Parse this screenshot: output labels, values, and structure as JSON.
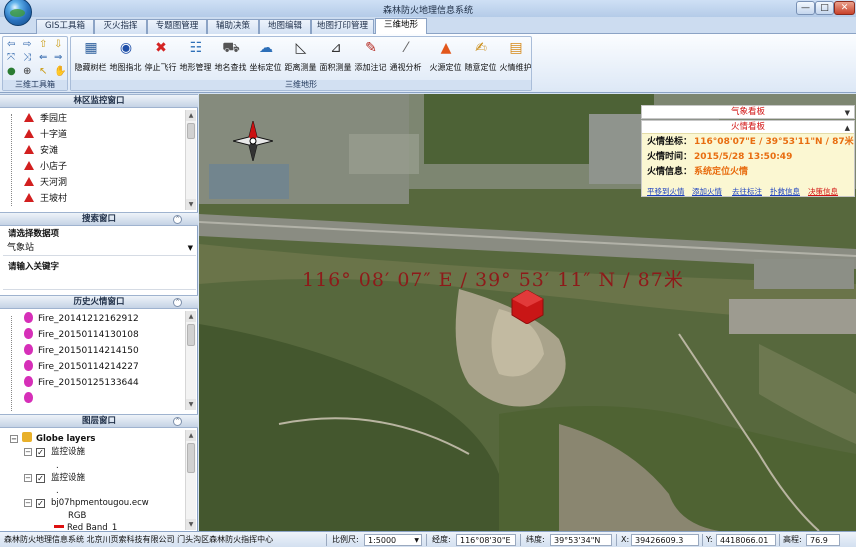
{
  "window": {
    "title": "森林防火地理信息系统",
    "min_glyph": "—",
    "max_glyph": "□",
    "close_glyph": "✕"
  },
  "tabs": [
    {
      "label": "GIS工具箱"
    },
    {
      "label": "灭火指挥"
    },
    {
      "label": "专题图管理"
    },
    {
      "label": "辅助决策"
    },
    {
      "label": "地图编辑"
    },
    {
      "label": "地图打印管理"
    },
    {
      "label": "三维地形",
      "active": true
    }
  ],
  "ribbon": {
    "group_3d_tools": "三维工具箱",
    "group_map": "三维地形",
    "buttons": [
      {
        "label": "隐藏树栏",
        "icon": "grid-icon"
      },
      {
        "label": "地图指北",
        "icon": "compass-icon"
      },
      {
        "label": "停止飞行",
        "icon": "stop-icon"
      },
      {
        "label": "地形管理",
        "icon": "terrain-icon"
      },
      {
        "label": "地名查找",
        "icon": "place-search-icon"
      },
      {
        "label": "坐标定位",
        "icon": "coordinate-icon"
      },
      {
        "label": "距离测量",
        "icon": "distance-icon"
      },
      {
        "label": "面积测量",
        "icon": "area-icon"
      },
      {
        "label": "添加注记",
        "icon": "annotation-icon"
      },
      {
        "label": "通视分析",
        "icon": "sightline-icon"
      },
      {
        "label": "火源定位",
        "icon": "fire-locate-icon"
      },
      {
        "label": "随意定位",
        "icon": "free-locate-icon"
      },
      {
        "label": "火情维护",
        "icon": "fire-maintain-icon"
      }
    ]
  },
  "left": {
    "monitor_title": "林区监控窗口",
    "monitor_items": [
      "季园庄",
      "十字道",
      "安滩",
      "小店子",
      "天河洞",
      "王坡村"
    ],
    "search_title": "搜索窗口",
    "search_label": "请选择数据项",
    "search_value": "气象站",
    "keyword_label": "请输入关键字",
    "keyword_value": "",
    "history_title": "历史火情窗口",
    "history_items": [
      "Fire_20141212162912",
      "Fire_20150114130108",
      "Fire_20150114214150",
      "Fire_20150114214227",
      "Fire_20150125133644"
    ],
    "layers_title": "图层窗口",
    "layers": {
      "root": "Globe layers",
      "l1": "监控设施",
      "l2": "监控设施",
      "l3": "bj07hpmentougou.ecw",
      "l4": "RGB",
      "l5": "Red Band_1"
    }
  },
  "map": {
    "coord_text": "116° 08′ 07″ E / 39° 53′ 11″ N / 87米"
  },
  "weather_panel": {
    "title": "气象看板"
  },
  "fire_panel": {
    "title": "火情看板",
    "coord_label": "火情坐标：",
    "coord_value": "116°08'07\"E / 39°53'11\"N / 87米",
    "time_label": "火情时间：",
    "time_value": "2015/5/28 13:50:49",
    "info_label": "火情信息：",
    "info_value": "系统定位火情",
    "links": [
      "平移到火情",
      "添加火情",
      "去往标注",
      "扑救信息",
      "决策信息"
    ]
  },
  "status": {
    "org": "森林防火地理信息系统  北京川页索科技有限公司  门头沟区森林防火指挥中心",
    "scale_label": "比例尺:",
    "scale_value": "1:5000",
    "lon_label": "经度:",
    "lon_value": "116°08'30\"E",
    "lat_label": "纬度:",
    "lat_value": "39°53'34\"N",
    "x_label": "X:",
    "x_value": "39426609.3",
    "y_label": "Y:",
    "y_value": "4418066.01",
    "elev_label": "高程:",
    "elev_value": "76.9"
  }
}
